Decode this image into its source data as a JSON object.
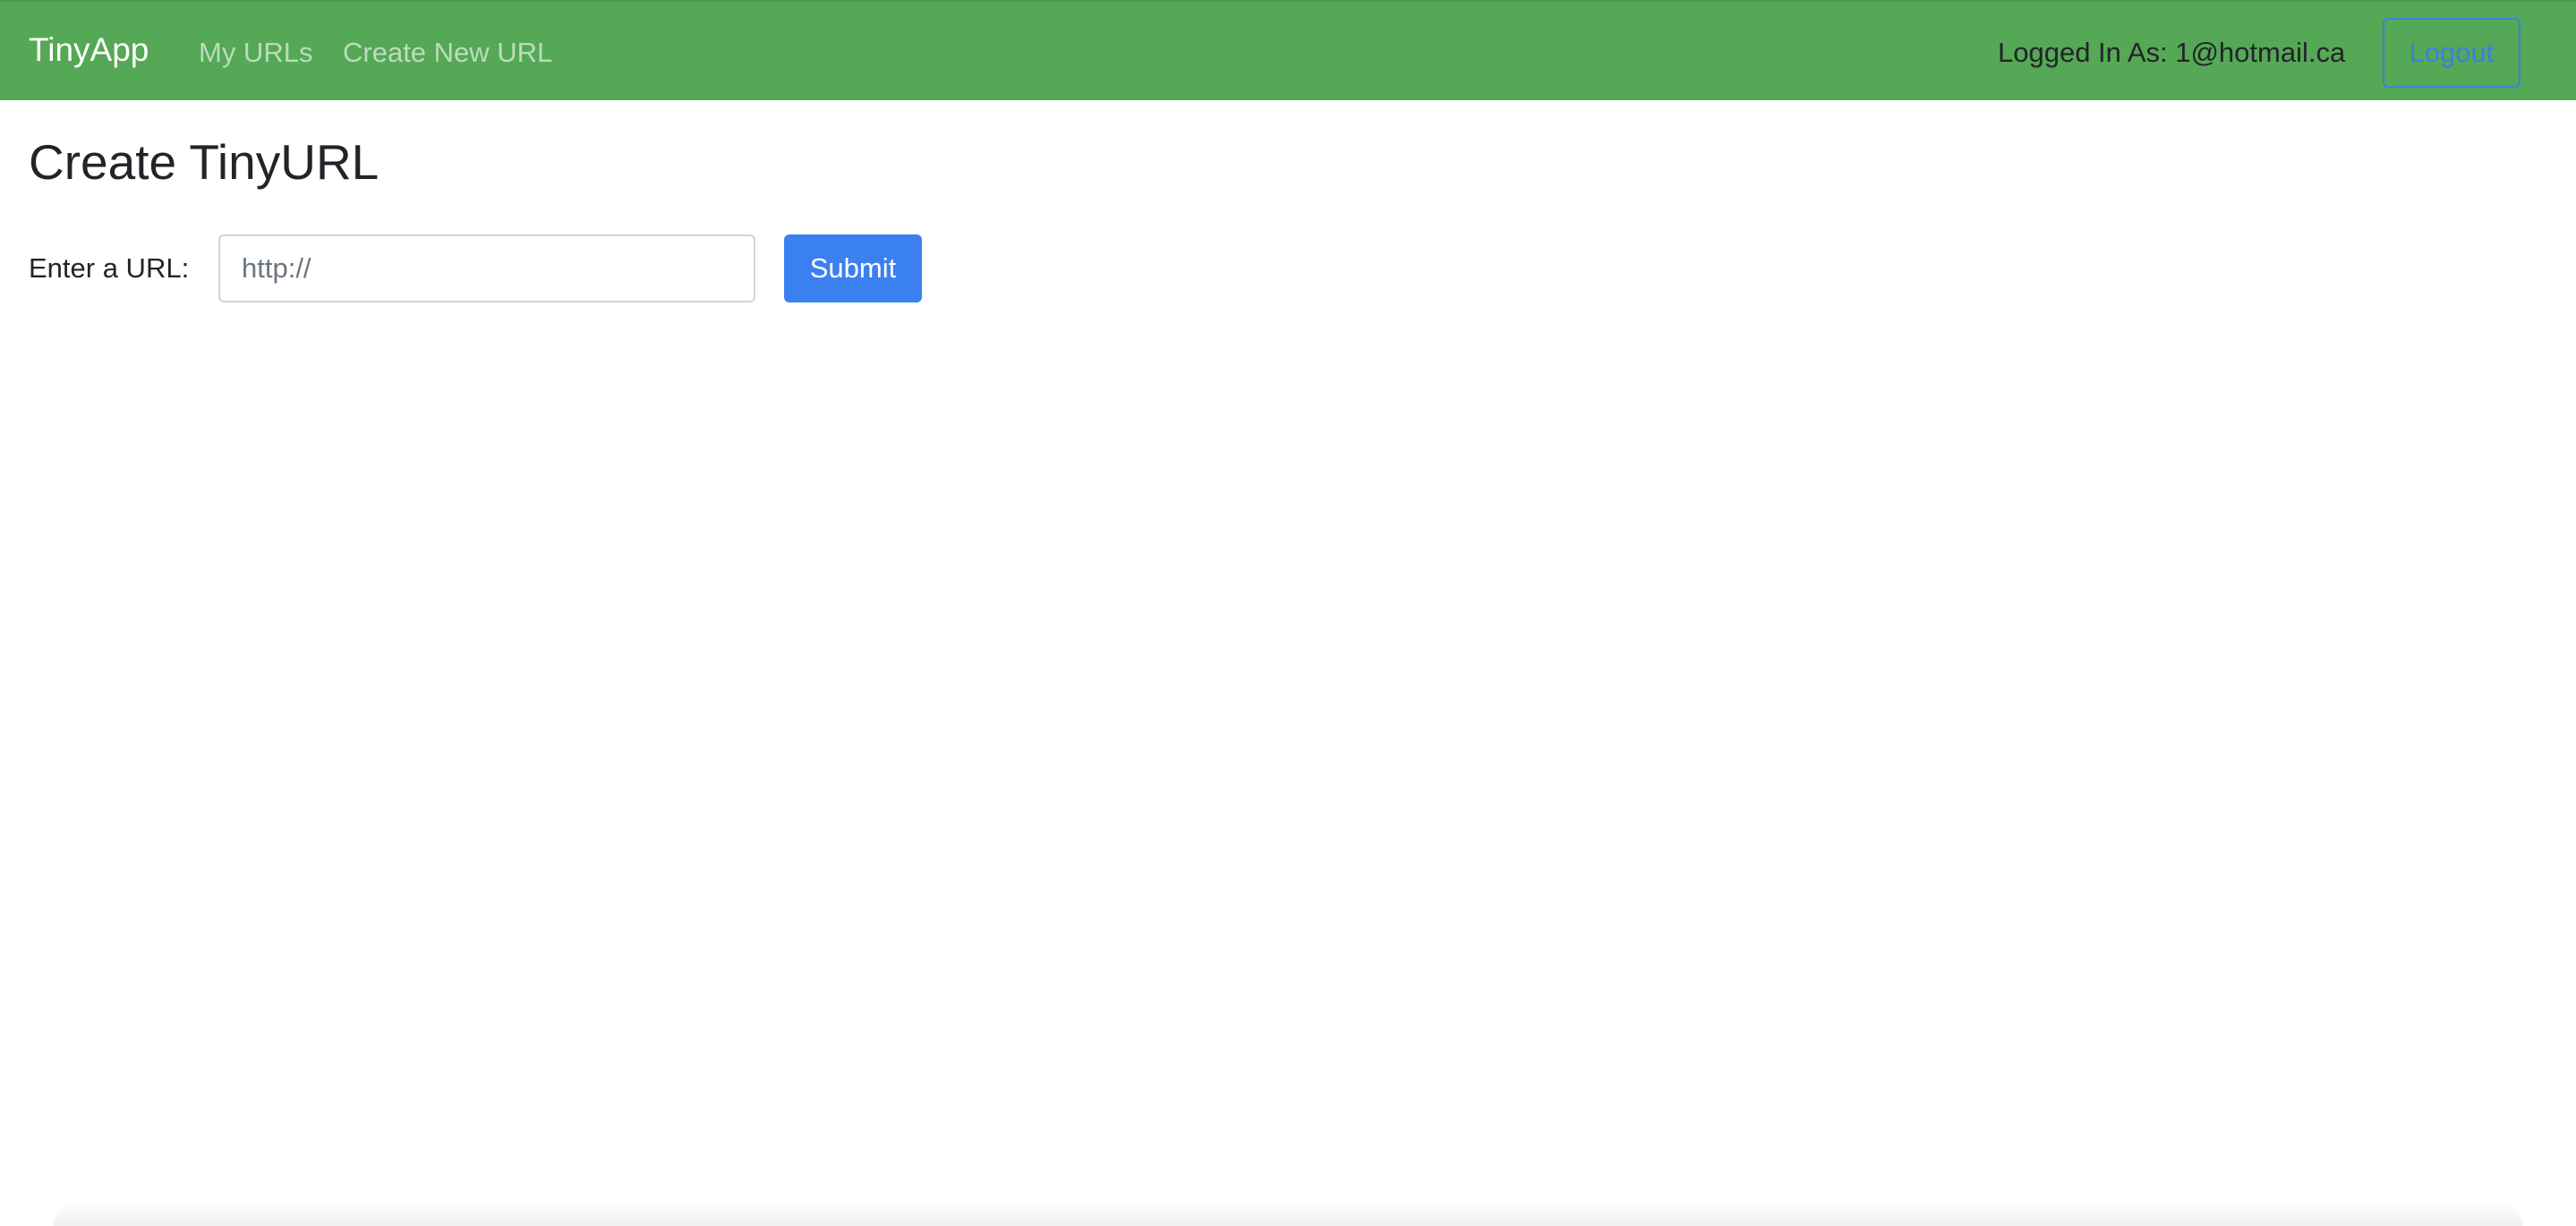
{
  "navbar": {
    "brand": "TinyApp",
    "links": [
      {
        "label": "My URLs"
      },
      {
        "label": "Create New URL"
      }
    ],
    "logged_in_text": "Logged In As: 1@hotmail.ca",
    "logout_label": "Logout",
    "background_color": "#55a855"
  },
  "main": {
    "title": "Create TinyURL",
    "form": {
      "label": "Enter a URL:",
      "input_value": "",
      "input_placeholder": "http://",
      "submit_label": "Submit",
      "submit_color": "#3a80f0"
    }
  }
}
